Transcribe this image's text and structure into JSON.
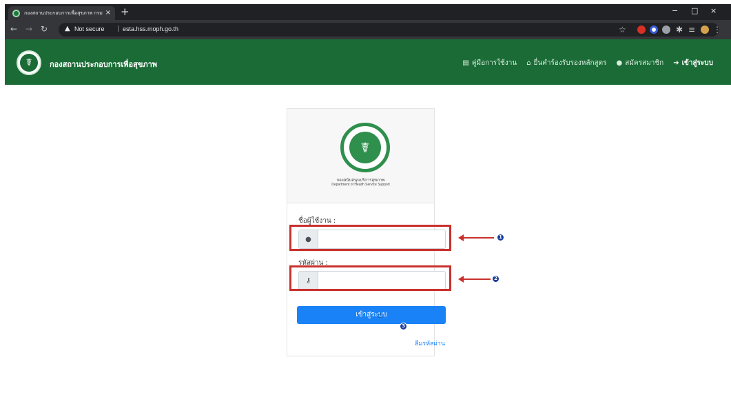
{
  "browser": {
    "tab_title": "กองสถานประกอบการเพื่อสุขภาพ กรม",
    "tab_close": "×",
    "new_tab": "+",
    "not_secure": "Not secure",
    "url": "esta.hss.moph.go.th",
    "separator": "|",
    "minimize": "−",
    "maximize": "□",
    "close": "×"
  },
  "site": {
    "brand_name": "กองสถานประกอบการเพื่อสุขภาพ",
    "nav": [
      {
        "label": "คู่มือการใช้งาน",
        "icon": "book-icon"
      },
      {
        "label": "ยื่นคำร้องรับรองหลักสูตร",
        "icon": "building-icon"
      },
      {
        "label": "สมัครสมาชิก",
        "icon": "user-icon"
      },
      {
        "label": "เข้าสู่ระบบ",
        "icon": "sign-in-icon"
      }
    ]
  },
  "login": {
    "dept_th": "กองสนับสนุนบริการสุขภาพ",
    "dept_en": "Department of Health Service Support",
    "username_label": "ชื่อผู้ใช้งาน :",
    "password_label": "รหัสผ่าน :",
    "username_value": "",
    "password_value": "",
    "submit_label": "เข้าสู่ระบบ",
    "forgot_label": "ลืมรหัสผ่าน"
  },
  "annotations": {
    "badge1": "1",
    "badge2": "2",
    "badge3": "3"
  },
  "colors": {
    "header_green": "#1a6b35",
    "button_blue": "#1a82f7",
    "highlight_red": "#c9302c",
    "badge_blue": "#1a3e9c"
  }
}
